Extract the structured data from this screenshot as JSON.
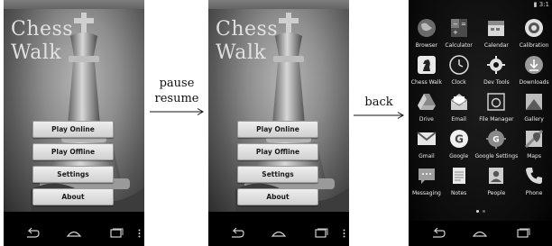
{
  "screen_before": {
    "title_line1": "Chess",
    "title_line2": "Walk",
    "menu": [
      {
        "label": "Play Online"
      },
      {
        "label": "Play Offline"
      },
      {
        "label": "Settings"
      },
      {
        "label": "About"
      }
    ]
  },
  "screen_after_pause": {
    "title_line1": "Chess",
    "title_line2": "Walk",
    "menu": [
      {
        "label": "Play Online"
      },
      {
        "label": "Play Offline"
      },
      {
        "label": "Settings"
      },
      {
        "label": "About"
      }
    ]
  },
  "transitions": {
    "first_line1": "pause",
    "first_line2": "resume",
    "second": "back"
  },
  "drawer": {
    "clock": "3:1",
    "apps": [
      {
        "label": "Browser",
        "icon": "globe-icon"
      },
      {
        "label": "Calculator",
        "icon": "calculator-icon"
      },
      {
        "label": "Calendar",
        "icon": "calendar-icon"
      },
      {
        "label": "Calibration",
        "icon": "target-icon"
      },
      {
        "label": "Chess Walk",
        "icon": "chess-knight-icon"
      },
      {
        "label": "Clock",
        "icon": "clock-icon"
      },
      {
        "label": "Dev Tools",
        "icon": "gear-icon"
      },
      {
        "label": "Downloads",
        "icon": "download-icon"
      },
      {
        "label": "Drive",
        "icon": "drive-icon"
      },
      {
        "label": "Email",
        "icon": "envelope-open-icon"
      },
      {
        "label": "File Manager",
        "icon": "folder-icon"
      },
      {
        "label": "Gallery",
        "icon": "photo-icon"
      },
      {
        "label": "Gmail",
        "icon": "gmail-icon"
      },
      {
        "label": "Google",
        "icon": "google-icon"
      },
      {
        "label": "Google Settings",
        "icon": "settings-g-icon"
      },
      {
        "label": "Maps",
        "icon": "map-icon"
      },
      {
        "label": "Messaging",
        "icon": "message-icon"
      },
      {
        "label": "Notes",
        "icon": "notes-icon"
      },
      {
        "label": "People",
        "icon": "contacts-icon"
      },
      {
        "label": "Phone",
        "icon": "phone-icon"
      }
    ]
  },
  "colors": {
    "page_background": "#ffffff",
    "button_gradient_top": "#efefef",
    "button_gradient_bottom": "#cfcfcf",
    "drawer_background": "#0b0b0b"
  }
}
